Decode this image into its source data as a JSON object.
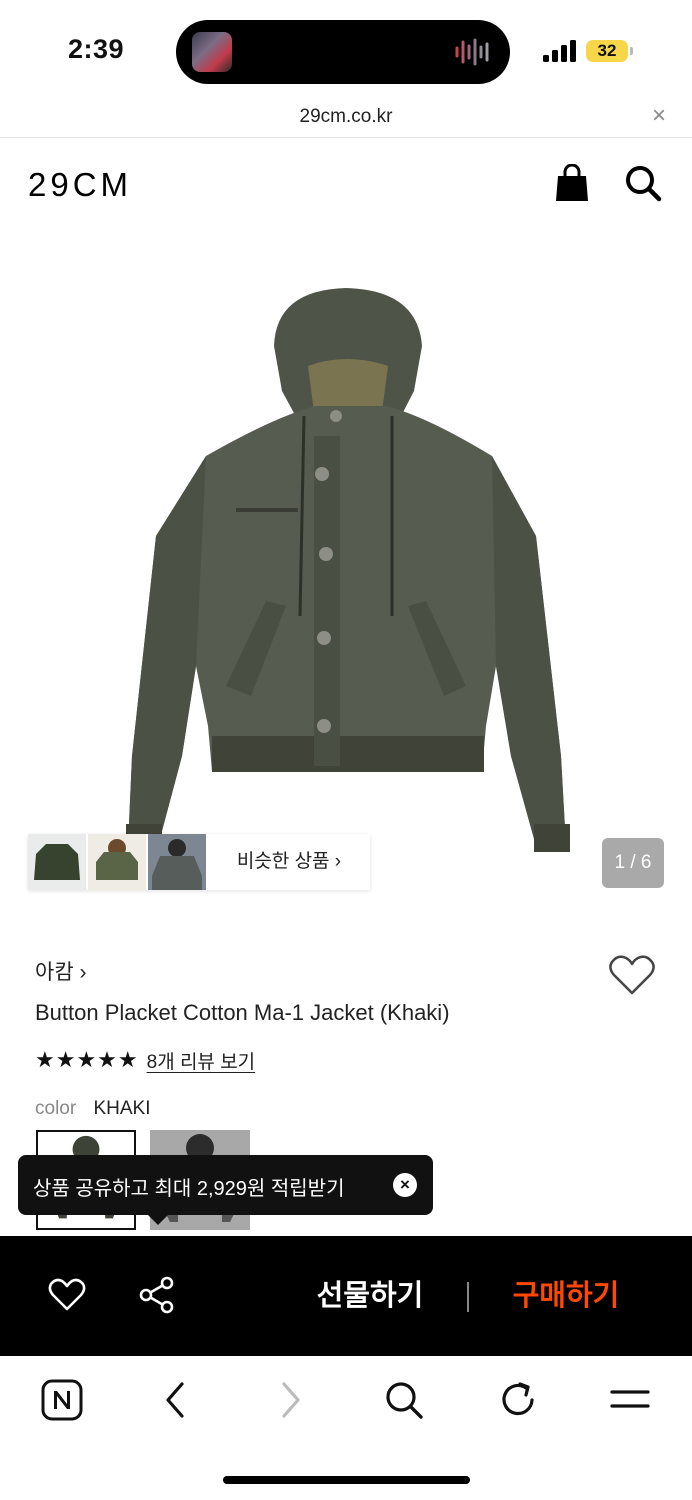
{
  "status_bar": {
    "time": "2:39",
    "battery": "32",
    "battery_color": "#f7d64a"
  },
  "browser": {
    "url": "29cm.co.kr",
    "close_icon": "×"
  },
  "header": {
    "logo": "29CM",
    "cart_icon": "shopping-bag-icon",
    "search_icon": "search-icon"
  },
  "gallery": {
    "similar_products_label": "비슷한 상품 ›",
    "page_counter": "1 / 6"
  },
  "product": {
    "brand": "아캄 ›",
    "name": "Button Placket Cotton Ma-1 Jacket (Khaki)",
    "stars": "★★★★★",
    "rating": 5,
    "review_link": "8개 리뷰 보기",
    "color_label": "color",
    "color_value": "KHAKI"
  },
  "toast": {
    "text": "상품 공유하고 최대 2,929원 적립받기",
    "close": "×"
  },
  "purchase_bar": {
    "gift_label": "선물하기",
    "buy_label": "구매하기",
    "buy_color": "#ff4800"
  },
  "browser_toolbar": {
    "items": [
      "naver-home-icon",
      "back-icon",
      "forward-icon",
      "search-icon",
      "reload-icon",
      "menu-icon"
    ]
  }
}
